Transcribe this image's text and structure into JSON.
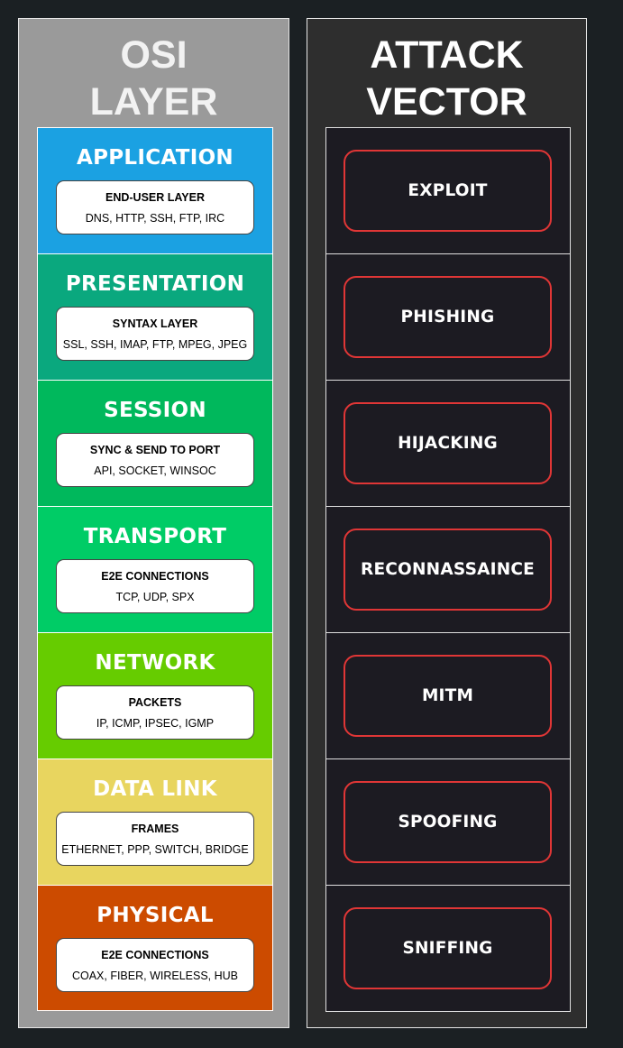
{
  "osi": {
    "title_line1": "OSI",
    "title_line2": "LAYER",
    "layers": [
      {
        "name": "APPLICATION",
        "card_title": "END-USER LAYER",
        "protocols": "DNS, HTTP, SSH, FTP, IRC",
        "color": "#1ba1e2"
      },
      {
        "name": "PRESENTATION",
        "card_title": "SYNTAX LAYER",
        "protocols": "SSL, SSH, IMAP, FTP, MPEG, JPEG",
        "color": "#0aa87e"
      },
      {
        "name": "SESSION",
        "card_title": "SYNC & SEND TO PORT",
        "protocols": "API, SOCKET, WINSOC",
        "color": "#00b85c"
      },
      {
        "name": "TRANSPORT",
        "card_title": "E2E CONNECTIONS",
        "protocols": "TCP, UDP, SPX",
        "color": "#00cc66"
      },
      {
        "name": "NETWORK",
        "card_title": "PACKETS",
        "protocols": "IP, ICMP, IPSEC, IGMP",
        "color": "#66cc00"
      },
      {
        "name": "DATA LINK",
        "card_title": "FRAMES",
        "protocols": "ETHERNET, PPP, SWITCH, BRIDGE",
        "color": "#e8d55f"
      },
      {
        "name": "PHYSICAL",
        "card_title": "E2E CONNECTIONS",
        "protocols": "COAX, FIBER, WIRELESS, HUB",
        "color": "#cc4b00"
      }
    ]
  },
  "attack": {
    "title_line1": "ATTACK",
    "title_line2": "VECTOR",
    "vectors": [
      "EXPLOIT",
      "PHISHING",
      "HIJACKING",
      "RECONNASSAINCE",
      "MITM",
      "SPOOFING",
      "SNIFFING"
    ],
    "border_color": "#e03636"
  }
}
